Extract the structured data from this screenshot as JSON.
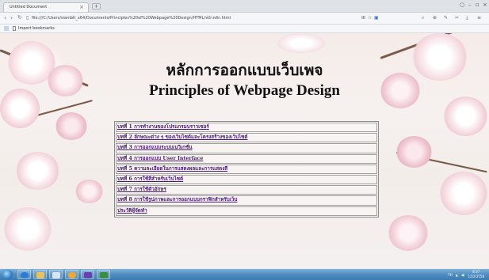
{
  "browser": {
    "tab_title": "Untitled Document",
    "tab_close": "×",
    "new_tab": "+",
    "address": "file:///C:/Users/siambit_x64/Documents/Principles%20of%20Webpage%20Design/HTML/หน้าหลัก.html",
    "bookmarks_bar": {
      "item_label": "Import bookmarks"
    }
  },
  "page": {
    "title_th": "หลักการออกแบบเว็บเพจ",
    "title_en": "Principles of Webpage Design",
    "toc": [
      "บทที่ 1 การทำงานของโปรแกรมบราวเซอร์",
      "บทที่ 2 ลักษณะต่าง ๆ ของเว็บไซต์และโครงสร้างของเว็บไซต์",
      "บทที่ 3 การออกแบบระบบเนวิเกชั่น",
      "บทที่ 4 การออกแบบ User Interface",
      "บทที่ 5 ความละเอียดในการแสดงผลและการแสดงสี",
      "บทที่ 6 การใช้สีสำหรับเว็บไซต์",
      "บทที่ 7 การใช้ตัวอักษร",
      "บทที่ 8 การใช้รูปภาพและการออกแบบกราฟิกสำหรับเว็บ",
      "ประวัติผู้จัดทำ"
    ]
  },
  "taskbar": {
    "clock_time": "8:37",
    "clock_date": "12/2/2558",
    "tray_lang": "TH"
  },
  "colors": {
    "link": "#4b1a7e",
    "taskbar": "#4f8dc0"
  }
}
